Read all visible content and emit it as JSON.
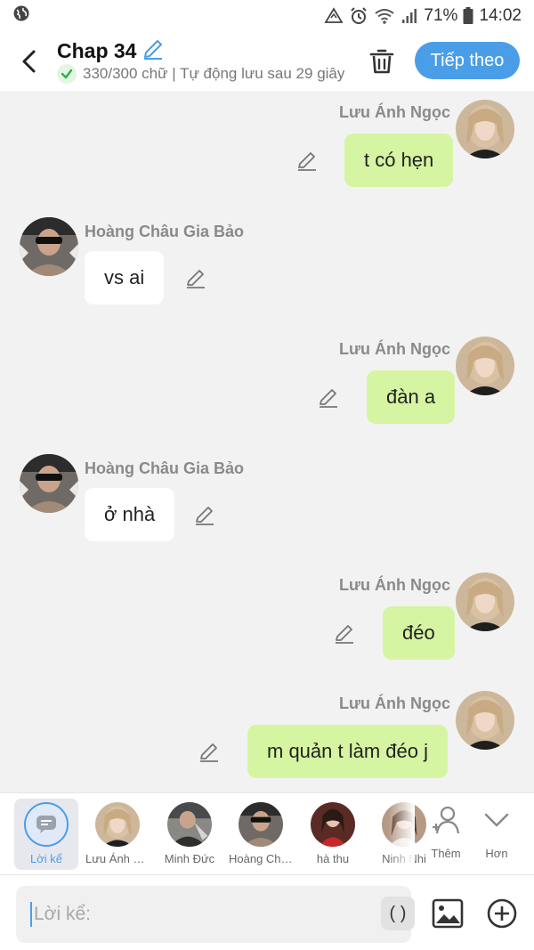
{
  "status_bar": {
    "battery_percent": "71%",
    "time": "14:02",
    "icons": [
      "globe-icon",
      "vibrate-icon",
      "alarm-icon",
      "wifi-icon",
      "signal-icon",
      "battery-icon"
    ]
  },
  "header": {
    "title": "Chap 34",
    "subtitle": "330/300 chữ | Tự động lưu sau 29 giây",
    "next_label": "Tiếp theo",
    "accent": "#4a9ee8"
  },
  "messages": [
    {
      "side": "right",
      "sender": "Lưu Ánh Ngọc",
      "text": "t có hẹn"
    },
    {
      "side": "left",
      "sender": "Hoàng Châu Gia Bảo",
      "text": "vs ai"
    },
    {
      "side": "right",
      "sender": "Lưu Ánh Ngọc",
      "text": "đàn a"
    },
    {
      "side": "left",
      "sender": "Hoàng Châu Gia Bảo",
      "text": "ở nhà"
    },
    {
      "side": "right",
      "sender": "Lưu Ánh Ngọc",
      "text": "đéo"
    },
    {
      "side": "right",
      "sender": "Lưu Ánh Ngọc",
      "text": "m quản t làm đéo j"
    }
  ],
  "characters": [
    {
      "label": "Lời kể",
      "active": true
    },
    {
      "label": "Lưu Ánh Ngọc"
    },
    {
      "label": "Minh Đức"
    },
    {
      "label": "Hoàng Châu Gia Bảo"
    },
    {
      "label": "hà thu"
    },
    {
      "label": "Ninh Nhi"
    }
  ],
  "tools": {
    "add_label": "Thêm",
    "more_label": "Hơn"
  },
  "input": {
    "placeholder": "Lời kể:",
    "paren_label": "( )"
  },
  "colors": {
    "bubble_right": "#d6f5a2",
    "bubble_left": "#ffffff",
    "background": "#f2f2f2"
  }
}
